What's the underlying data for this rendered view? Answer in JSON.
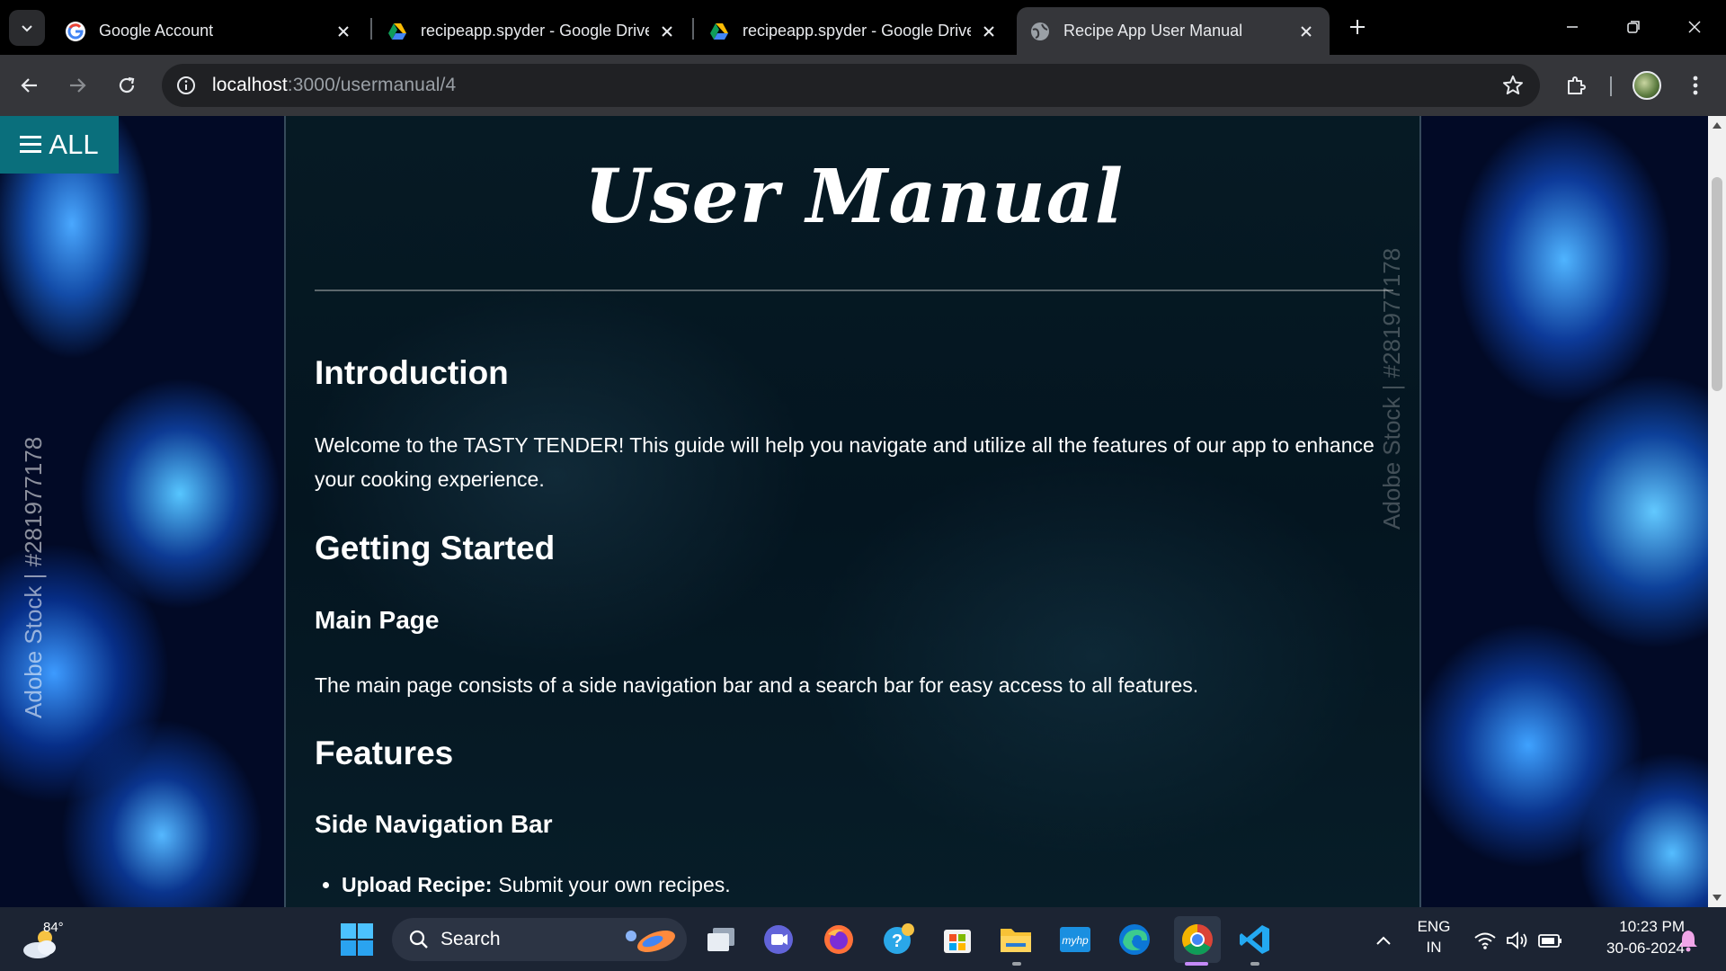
{
  "browser": {
    "tabs": [
      {
        "title": "Google Account",
        "favicon": "google-g-icon",
        "active": false
      },
      {
        "title": "recipeapp.spyder - Google Drive",
        "favicon": "google-drive-icon",
        "active": false
      },
      {
        "title": "recipeapp.spyder - Google Drive",
        "favicon": "google-drive-icon",
        "active": false
      },
      {
        "title": "Recipe App User Manual",
        "favicon": "globe-icon",
        "active": true
      }
    ],
    "url_host": "localhost",
    "url_rest": ":3000/usermanual/4"
  },
  "page": {
    "menu_label": "ALL",
    "title": "User Manual",
    "watermark": "Adobe Stock | #281977178",
    "sections": {
      "intro_heading": "Introduction",
      "intro_text": "Welcome to the TASTY TENDER! This guide will help you navigate and utilize all the features of our app to enhance your cooking experience.",
      "getting_started_heading": "Getting Started",
      "main_page_heading": "Main Page",
      "main_page_text": "The main page consists of a side navigation bar and a search bar for easy access to all features.",
      "features_heading": "Features",
      "side_nav_heading": "Side Navigation Bar",
      "feature_items": [
        {
          "term": "Upload Recipe:",
          "desc": "Submit your own recipes."
        }
      ]
    }
  },
  "taskbar": {
    "weather_temp": "84°",
    "search_label": "Search",
    "lang_top": "ENG",
    "lang_bottom": "IN",
    "time": "10:23 PM",
    "date": "30-06-2024"
  },
  "colors": {
    "menu_button": "#0a6f7c",
    "taskbar": "#1c2433",
    "active_tab": "#35363a"
  }
}
